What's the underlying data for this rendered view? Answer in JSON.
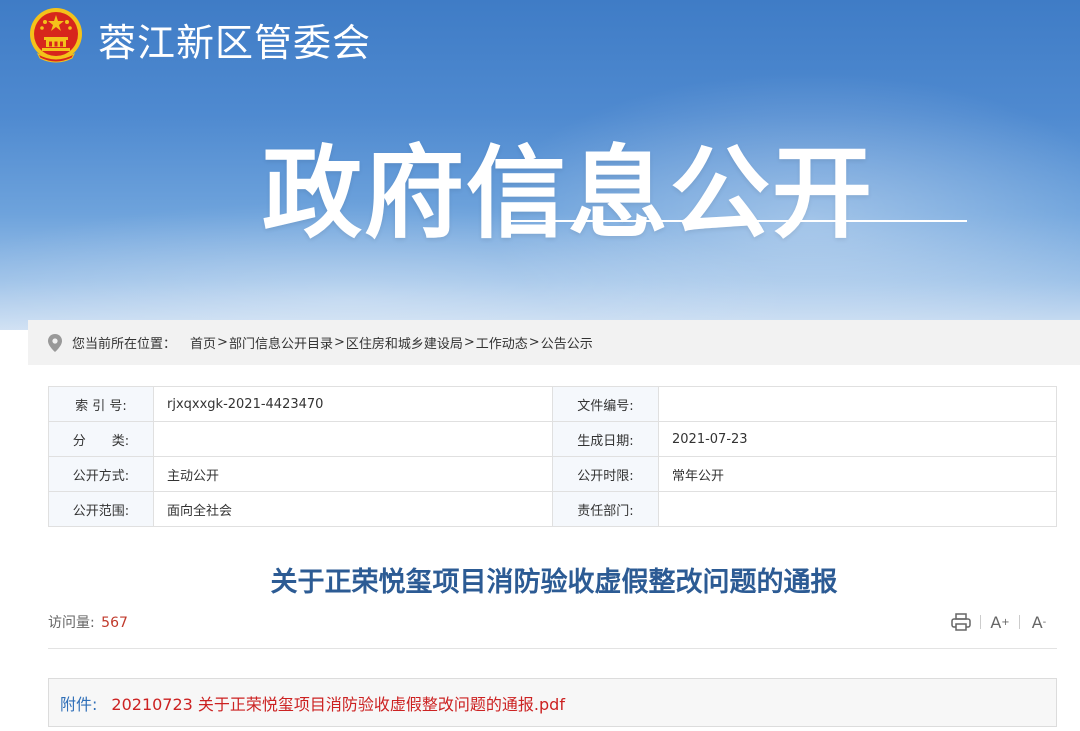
{
  "header": {
    "site_name": "蓉江新区管委会",
    "banner_title": "政府信息公开",
    "colors": {
      "banner_blue": "#3f7cc6",
      "emblem_red": "#d7261c",
      "emblem_gold": "#f4c21a"
    }
  },
  "breadcrumb": {
    "prefix": "您当前所在位置：",
    "items": [
      "首页",
      "部门信息公开目录",
      "区住房和城乡建设局",
      "工作动态",
      "公告公示"
    ],
    "separator": ">",
    "icon": "location-pin-icon"
  },
  "info": {
    "index_label": "索 引 号:",
    "index_value": "rjxqxxgk-2021-4423470",
    "docno_label": "文件编号:",
    "docno_value": "",
    "category_label": "分　　类:",
    "category_value": "",
    "date_label": "生成日期:",
    "date_value": "2021-07-23",
    "method_label": "公开方式:",
    "method_value": "主动公开",
    "period_label": "公开时限:",
    "period_value": "常年公开",
    "scope_label": "公开范围:",
    "scope_value": "面向全社会",
    "dept_label": "责任部门:",
    "dept_value": ""
  },
  "document": {
    "title": "关于正荣悦玺项目消防验收虚假整改问题的通报",
    "title_color": "#2c5b94",
    "visits_label": "访问量:",
    "visits_count": "567"
  },
  "tools": {
    "print_icon": "printer-icon",
    "font_increase": "A",
    "font_increase_sign": "+",
    "font_decrease": "A",
    "font_decrease_sign": "-"
  },
  "attachment": {
    "label": "附件:",
    "filename": "20210723 关于正荣悦玺项目消防验收虚假整改问题的通报.pdf",
    "label_color": "#2f6fb8",
    "file_color": "#cc2222"
  }
}
